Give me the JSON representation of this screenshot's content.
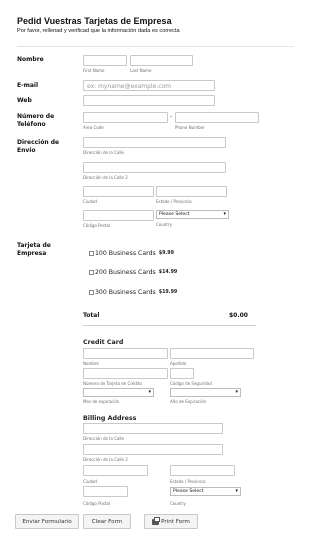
{
  "header": {
    "title": "Pedid Vuestras Tarjetas de Empresa",
    "subtitle": "Por favor, rellenad y verificad que la información dada es correcta"
  },
  "labels": {
    "name": "Nombre",
    "email": "E-mail",
    "web": "Web",
    "phone": "Número de Teléfono",
    "address": "Dirección de Envío",
    "card": "Tarjeta de Empresa"
  },
  "name": {
    "first_sub": "First Name",
    "last_sub": "Last Name"
  },
  "email": {
    "placeholder": "ex: myname@example.com"
  },
  "phone": {
    "separator": "-",
    "area_sub": "Area Code",
    "number_sub": "Phone Number"
  },
  "address": {
    "street_sub": "Dirección de la Calle",
    "street2_sub": "Dirección de la Calle 2",
    "city_sub": "Ciudad",
    "state_sub": "Estado / Provincia",
    "zip_sub": "Código Postal",
    "country_sub": "Country",
    "country_value": "Please Select"
  },
  "products": [
    {
      "label": "100 Business Cards",
      "price": "$9.99"
    },
    {
      "label": "200 Business Cards",
      "price": "$14.99"
    },
    {
      "label": "300 Business Cards",
      "price": "$19.99"
    }
  ],
  "total": {
    "label": "Total",
    "value": "$0.00"
  },
  "credit_card": {
    "heading": "Credit Card",
    "first_sub": "Nombre",
    "last_sub": "Apellido",
    "number_sub": "Número de Tarjeta de Crédito",
    "security_sub": "Código de Seguridad",
    "month_sub": "Mes de expiración",
    "year_sub": "Año de Expiración"
  },
  "billing": {
    "heading": "Billing Address",
    "street_sub": "Dirección de la Calle",
    "street2_sub": "Dirección de la Calle 2",
    "city_sub": "Ciudad",
    "state_sub": "Estado / Provincia",
    "zip_sub": "Código Postal",
    "country_sub": "Country",
    "country_value": "Please Select"
  },
  "buttons": {
    "submit": "Enviar Formulario",
    "clear": "Clear Form",
    "print": "Print Form"
  }
}
